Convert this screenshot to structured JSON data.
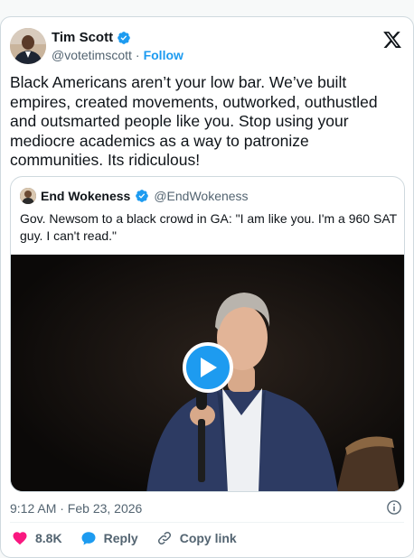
{
  "author": {
    "display_name": "Tim Scott",
    "handle": "@votetimscott",
    "separator": "·",
    "follow_label": "Follow"
  },
  "tweet": {
    "text": "Black Americans aren’t your low bar. We’ve built empires, created movements, outworked, outhustled and outsmarted people like you. Stop using your mediocre academics as a way to patronize communities. Its ridiculous!"
  },
  "quote": {
    "display_name": "End Wokeness",
    "handle": "@EndWokeness",
    "text": "Gov. Newsom to a black crowd in GA: \"I am like you. I'm a 960 SAT guy. I can't read.\""
  },
  "meta": {
    "timestamp": "9:12 AM · Feb 23, 2026"
  },
  "actions": {
    "like_count": "8.8K",
    "reply_label": "Reply",
    "copy_link_label": "Copy link"
  },
  "colors": {
    "brand": "#1d9bf0",
    "like": "#f91880",
    "text": "#0f1419",
    "secondary": "#536471"
  },
  "icons": [
    "verified-badge-icon",
    "x-logo-icon",
    "play-icon",
    "info-icon",
    "heart-icon",
    "reply-icon",
    "link-icon"
  ]
}
